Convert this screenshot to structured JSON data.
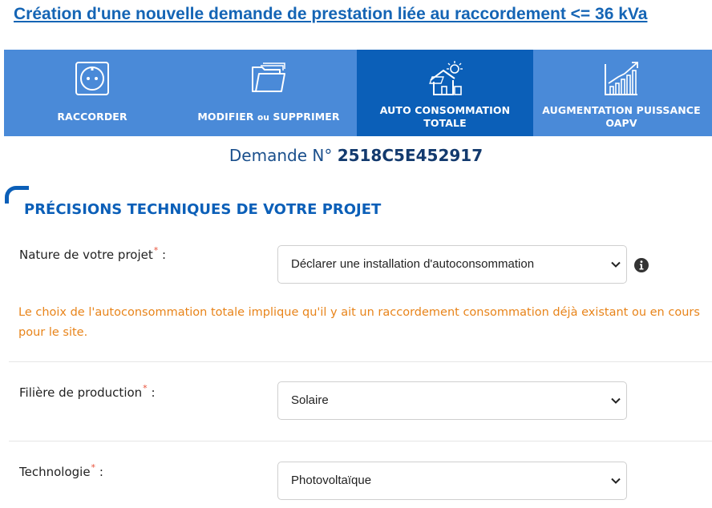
{
  "page": {
    "title": "Création d'une nouvelle demande de prestation liée au raccordement <= 36 kVa"
  },
  "tabs": [
    {
      "label": "RACCORDER",
      "icon": "power-outlet-icon",
      "active": false
    },
    {
      "label_main": "MODIFIER ",
      "label_small": "ou",
      "label_rest": " SUPPRIMER",
      "icon": "folder-open-icon",
      "active": false
    },
    {
      "line1": "AUTO CONSOMMATION",
      "line2": "TOTALE",
      "icon": "solar-house-icon",
      "active": true
    },
    {
      "line1": "AUGMENTATION PUISSANCE",
      "line2": "OAPV",
      "icon": "growth-chart-icon",
      "active": false
    }
  ],
  "demande": {
    "label": "Demande N°",
    "number": "2518C5E452917"
  },
  "section": {
    "title": "PRÉCISIONS TECHNIQUES DE VOTRE PROJET"
  },
  "fields": {
    "nature": {
      "label": "Nature de votre projet",
      "required_mark": "*",
      "suffix": " :",
      "value": "Déclarer une installation d'autoconsommation"
    },
    "filiere": {
      "label": "Filière de production",
      "required_mark": "*",
      "suffix": " :",
      "value": "Solaire"
    },
    "technologie": {
      "label": "Technologie",
      "required_mark": "*",
      "suffix": " :",
      "value": "Photovoltaïque"
    }
  },
  "note": "Le choix de l'autoconsommation totale implique qu'il y ait un raccordement consommation déjà existant ou en cours pour le site.",
  "colors": {
    "tab_bg": "#4a8ad8",
    "tab_active_bg": "#0b5fb8",
    "title_blue": "#1565b5",
    "note_orange": "#e8841a",
    "required_red": "#e8513a"
  }
}
